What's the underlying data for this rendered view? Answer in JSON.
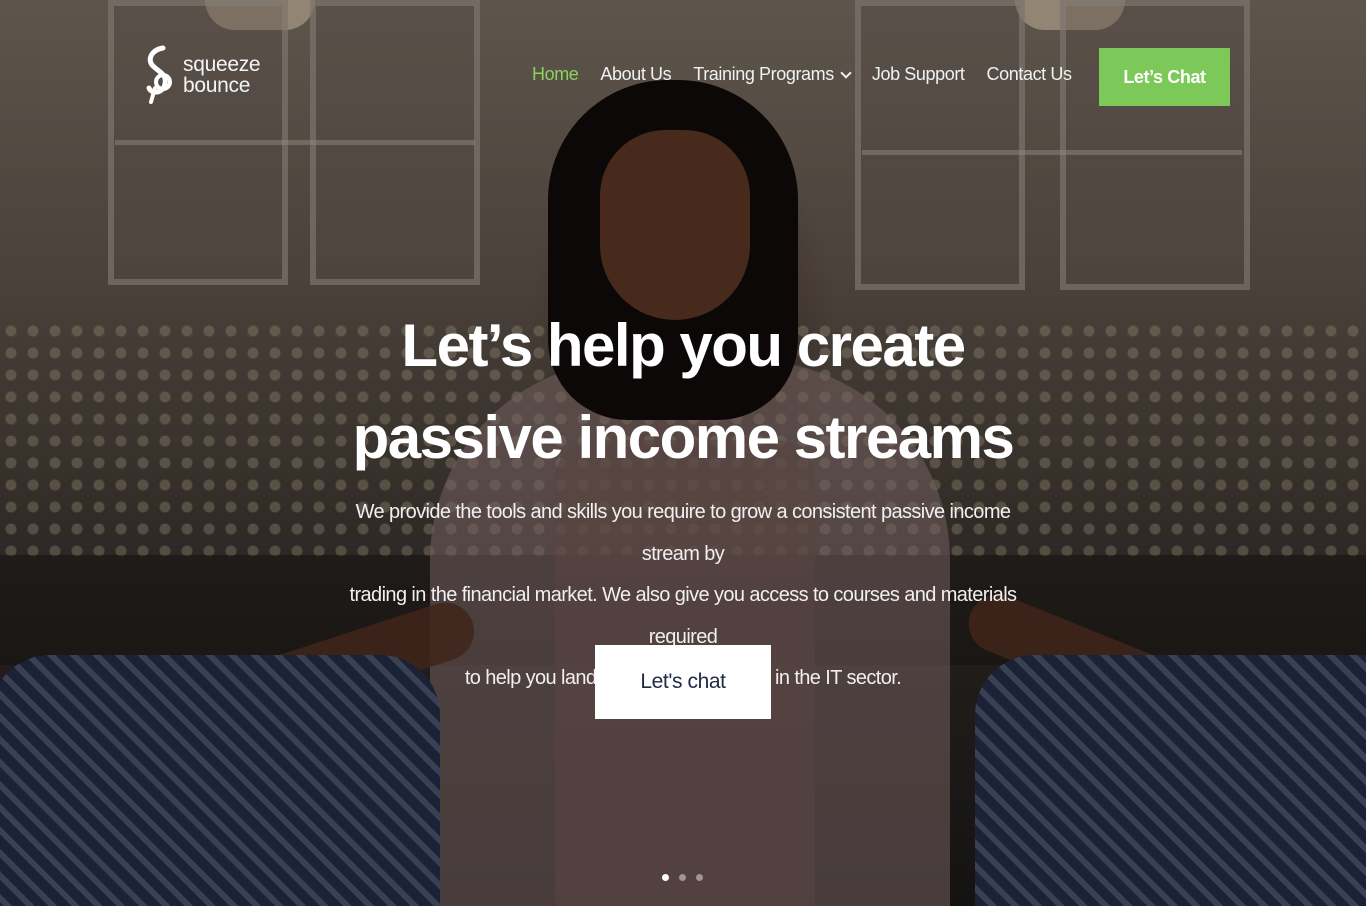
{
  "brand": {
    "logo_line1": "squeeze",
    "logo_line2": "bounce",
    "logo_icon": "squeeze-bounce-logo-mark",
    "accent_color": "#7cc95a"
  },
  "nav": {
    "items": [
      {
        "label": "Home",
        "active": true
      },
      {
        "label": "About Us",
        "active": false
      },
      {
        "label": "Training Programs",
        "active": false,
        "has_dropdown": true
      },
      {
        "label": "Job Support",
        "active": false
      },
      {
        "label": "Contact Us",
        "active": false
      }
    ],
    "cta_label": "Let’s Chat"
  },
  "hero": {
    "headline_line1": "Let’s help you create",
    "headline_line2": "passive income streams",
    "subtext_line1": "We provide the tools and skills you require to grow a consistent passive income stream by",
    "subtext_line2": "trading in the financial market. We also give you access to courses and materials required",
    "subtext_line3": "to help you land a 6-figure paying job in the IT sector.",
    "cta_label": "Let's chat"
  },
  "slider": {
    "total_slides": 3,
    "active_slide": 1
  }
}
